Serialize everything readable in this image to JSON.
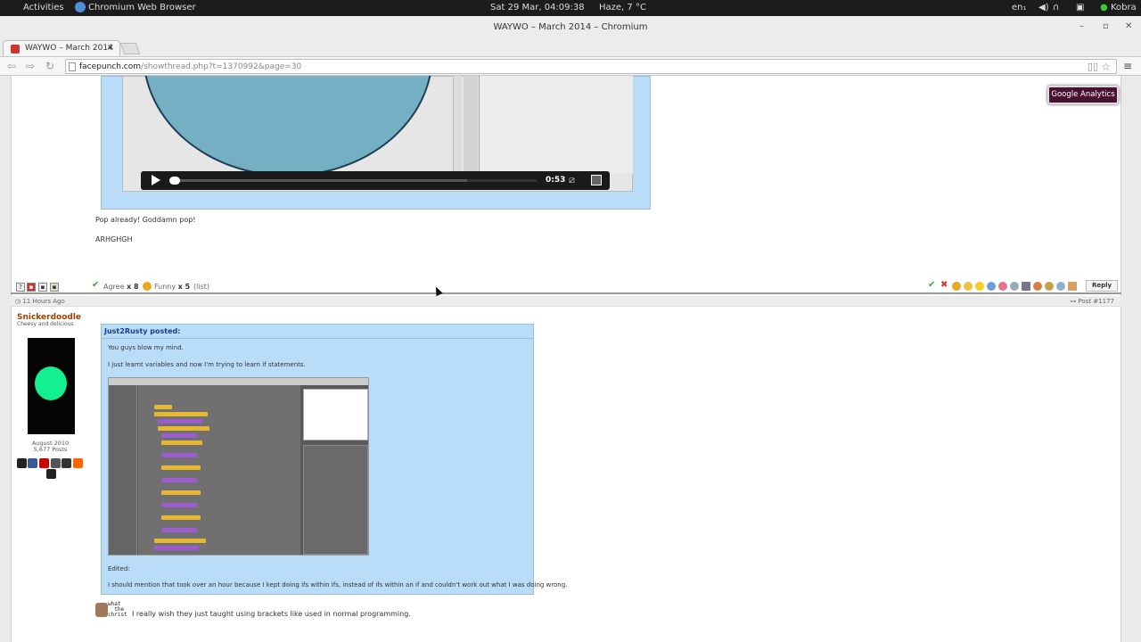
{
  "topbar": {
    "activities": "Activities",
    "app_name": "Chromium Web Browser",
    "clock": "Sat 29 Mar, 04:09:38",
    "weather": "Haze, 7 °C",
    "keyboard": "en₁",
    "user": "Kobra"
  },
  "window": {
    "title": "WAYWO – March 2014 – Chromium",
    "tab_label": "WAYWO – March 2014",
    "url_host": "facepunch.com",
    "url_path": "/showthread.php?t=1370992&page=30"
  },
  "post1": {
    "line1": "Pop already! Goddamn pop!",
    "line2": "ARHGHGH",
    "video_time": "0:53",
    "progress": 0.0
  },
  "ratings": {
    "agree_label": "Agree",
    "agree_count": "x 8",
    "funny_label": "Funny",
    "funny_count": "x 5",
    "list_label": "(list)",
    "reply_label": "Reply"
  },
  "post2": {
    "time_ago": "11 Hours Ago",
    "post_number": "Post #1177",
    "username": "Snickerdoodle",
    "user_title": "Cheesy and delicious",
    "join_date": "August 2010",
    "post_count": "5,677 Posts",
    "quote_header": "Just2Rusty posted:",
    "quote_line1": "You guys blow my mind.",
    "quote_line2": "I just learnt variables and now I'm trying to learn if statements.",
    "edited_label": "Edited:",
    "quote_line3": "I should mention that took over an hour because I kept doing ifs within ifs, instead of ifs within an if and couldn't work out what I was doing wrong.",
    "scribble": "what\n  the\nchrist",
    "reply_text": "I really wish they just taught using brackets like used in normal programming."
  },
  "extension_button": "Google Analytics"
}
